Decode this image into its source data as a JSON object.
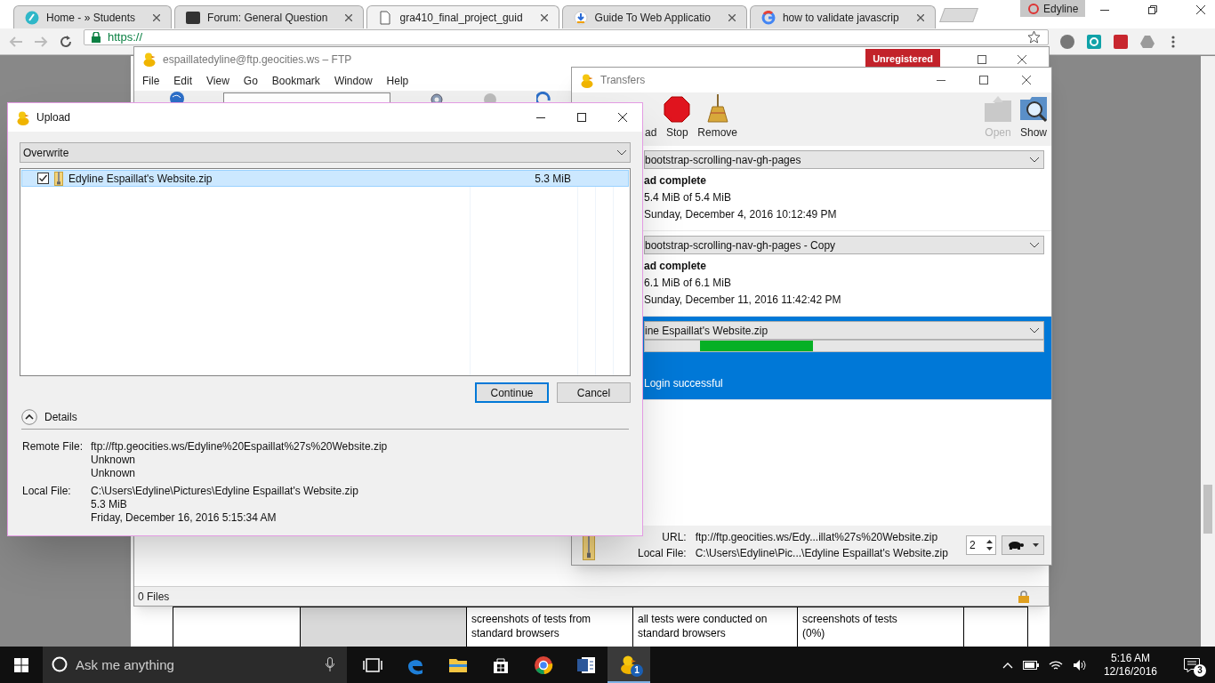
{
  "browser": {
    "tabs": [
      {
        "label": "Home - » Students",
        "selected": false
      },
      {
        "label": "Forum: General Question",
        "selected": false
      },
      {
        "label": "gra410_final_project_guid",
        "selected": true
      },
      {
        "label": "Guide To Web Applicatio",
        "selected": false
      },
      {
        "label": "how to validate javascrip",
        "selected": false
      }
    ],
    "profile": "Edyline",
    "address": "https://"
  },
  "document_table": {
    "cells": [
      "screenshots of tests from\nstandard browsers",
      "all tests were conducted on\nstandard browsers",
      "screenshots of tests\n(0%)"
    ]
  },
  "ftp_window": {
    "title": "espaillatedyline@ftp.geocities.ws – FTP",
    "badge": "Unregistered",
    "menu": [
      "File",
      "Edit",
      "View",
      "Go",
      "Bookmark",
      "Window",
      "Help"
    ],
    "status_bar": "0 Files"
  },
  "transfers_window": {
    "title": "Transfers",
    "toolbar": [
      {
        "label": "ad",
        "disabled": false
      },
      {
        "label": "Stop",
        "disabled": false
      },
      {
        "label": "Remove",
        "disabled": false
      },
      {
        "label": "Open",
        "disabled": true
      },
      {
        "label": "Show",
        "disabled": false
      }
    ],
    "transfers": [
      {
        "name": "bootstrap-scrolling-nav-gh-pages",
        "status": "ad complete",
        "size": "5.4 MiB of 5.4 MiB",
        "date": "Sunday, December 4, 2016 10:12:49 PM",
        "kind": "complete",
        "selected": false
      },
      {
        "name": "bootstrap-scrolling-nav-gh-pages - Copy",
        "status": "ad complete",
        "size": "6.1 MiB of 6.1 MiB",
        "date": "Sunday, December 11, 2016 11:42:42 PM",
        "kind": "complete",
        "selected": false
      },
      {
        "name": "ine Espaillat's Website.zip",
        "kind": "running",
        "message": "Login successful",
        "selected": true
      }
    ],
    "url_label": "URL:",
    "url": "ftp://ftp.geocities.ws/Edy...illat%27s%20Website.zip",
    "local_label": "Local File:",
    "local_file": "C:\\Users\\Edyline\\Pic...\\Edyline Espaillat's Website.zip",
    "connections": "2"
  },
  "upload_dialog": {
    "title": "Upload",
    "action": "Overwrite",
    "files": [
      {
        "name": "Edyline Espaillat's Website.zip",
        "size": "5.3 MiB",
        "checked": true,
        "selected": true
      }
    ],
    "buttons": [
      {
        "label": "Continue",
        "default": true
      },
      {
        "label": "Cancel",
        "default": false
      }
    ],
    "details": {
      "label": "Details",
      "expanded": true,
      "remote_label": "Remote File:",
      "remote_lines": [
        "ftp://ftp.geocities.ws/Edyline%20Espaillat%27s%20Website.zip",
        "Unknown",
        "Unknown"
      ],
      "local_label": "Local File:",
      "local_lines": [
        "C:\\Users\\Edyline\\Pictures\\Edyline Espaillat's Website.zip",
        "5.3 MiB",
        "Friday, December 16, 2016 5:15:34 AM"
      ]
    }
  },
  "taskbar": {
    "search_placeholder": "Ask me anything",
    "app_badge": "1",
    "time": "5:16 AM",
    "date": "12/16/2016",
    "notifications": "3"
  }
}
